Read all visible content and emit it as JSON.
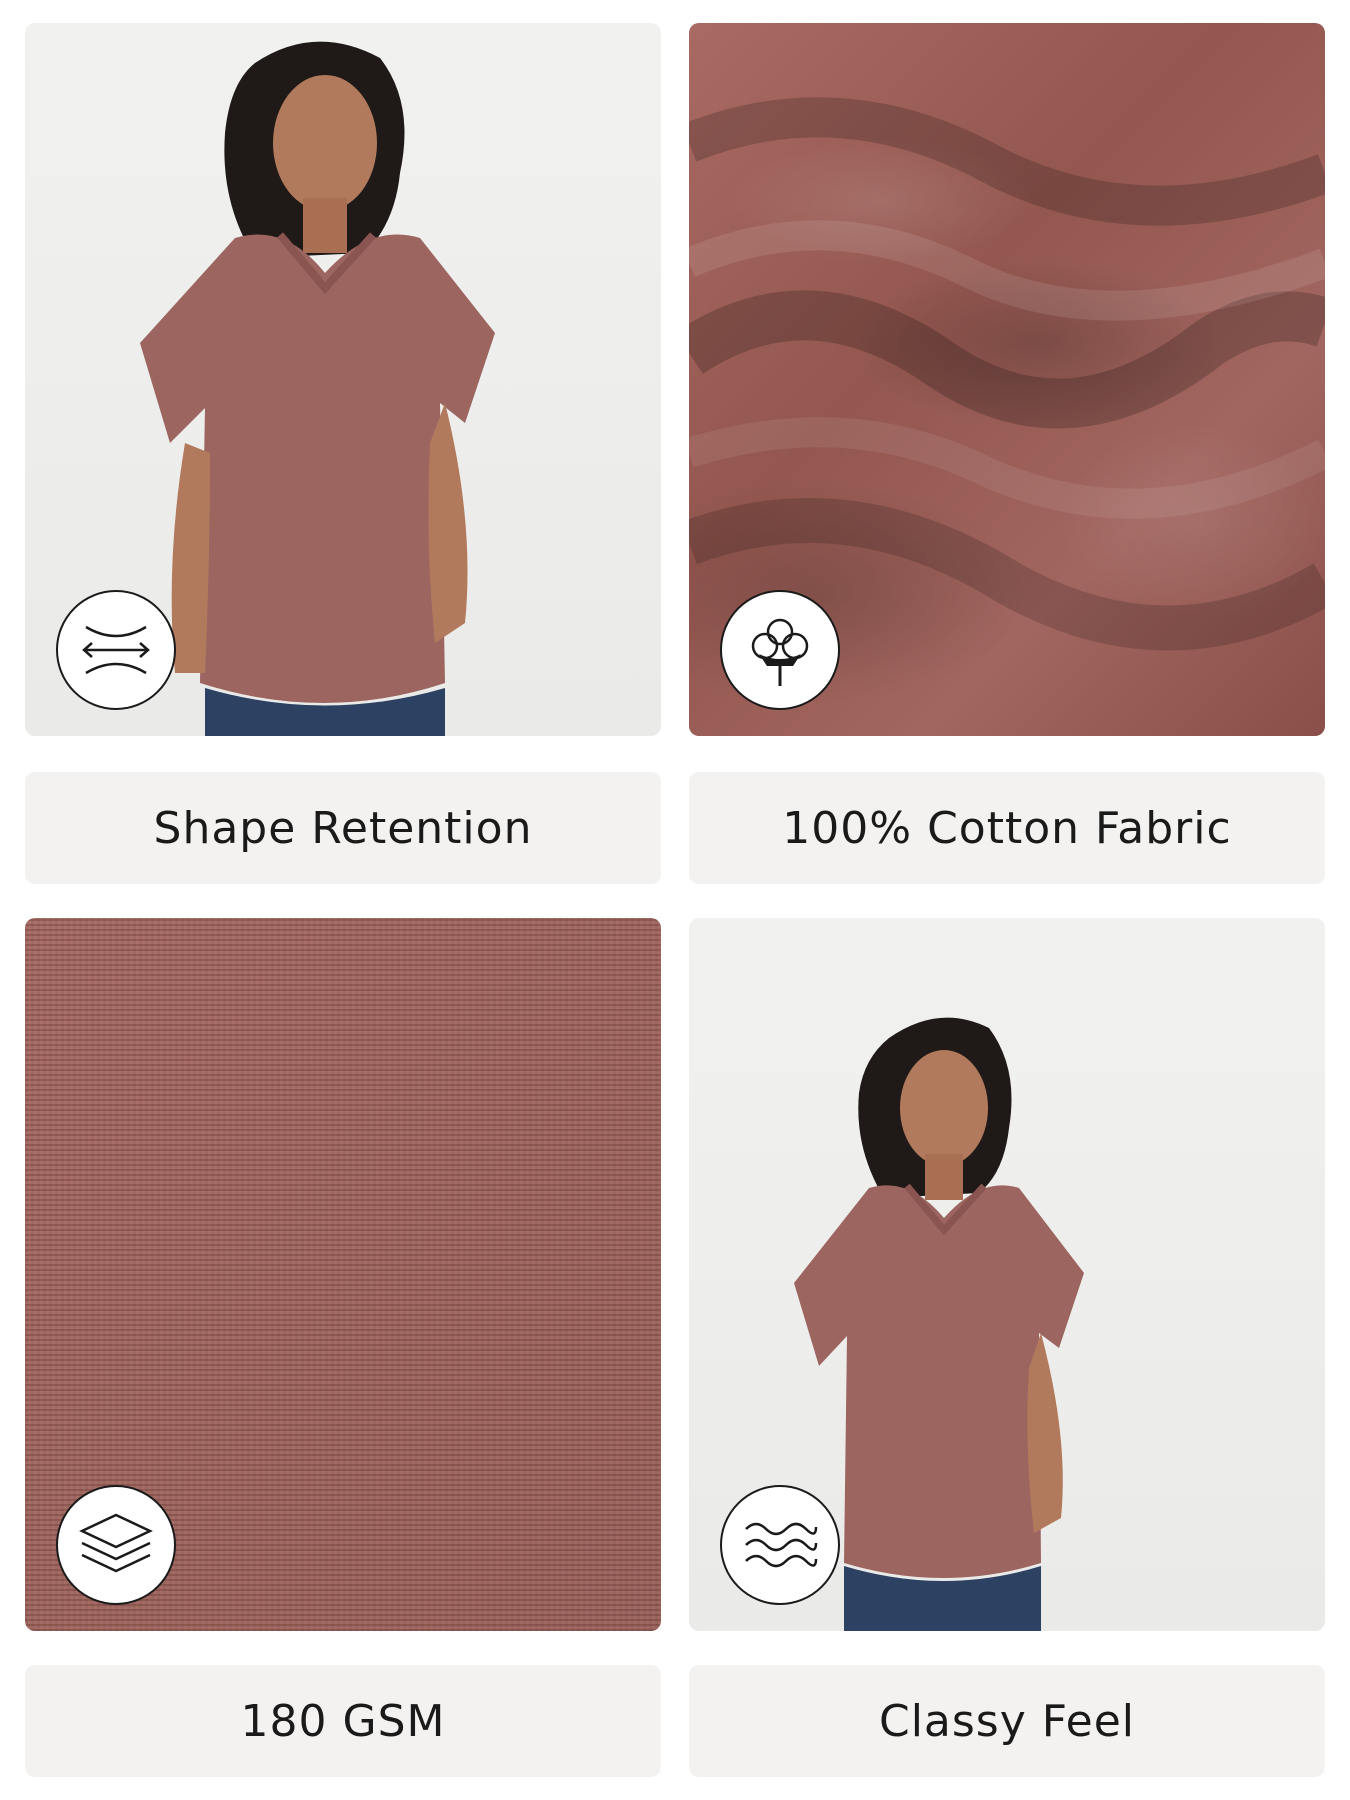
{
  "tiles": [
    {
      "label": "Shape Retention",
      "icon": "shape-retention-icon"
    },
    {
      "label": "100% Cotton Fabric",
      "icon": "cotton-flower-icon"
    },
    {
      "label": "180 GSM",
      "icon": "layers-icon"
    },
    {
      "label": "Classy Feel",
      "icon": "waves-icon"
    }
  ],
  "colors": {
    "fabric": "#a0625b",
    "label_bg": "#f3f2f0",
    "text": "#1a1a1a"
  }
}
